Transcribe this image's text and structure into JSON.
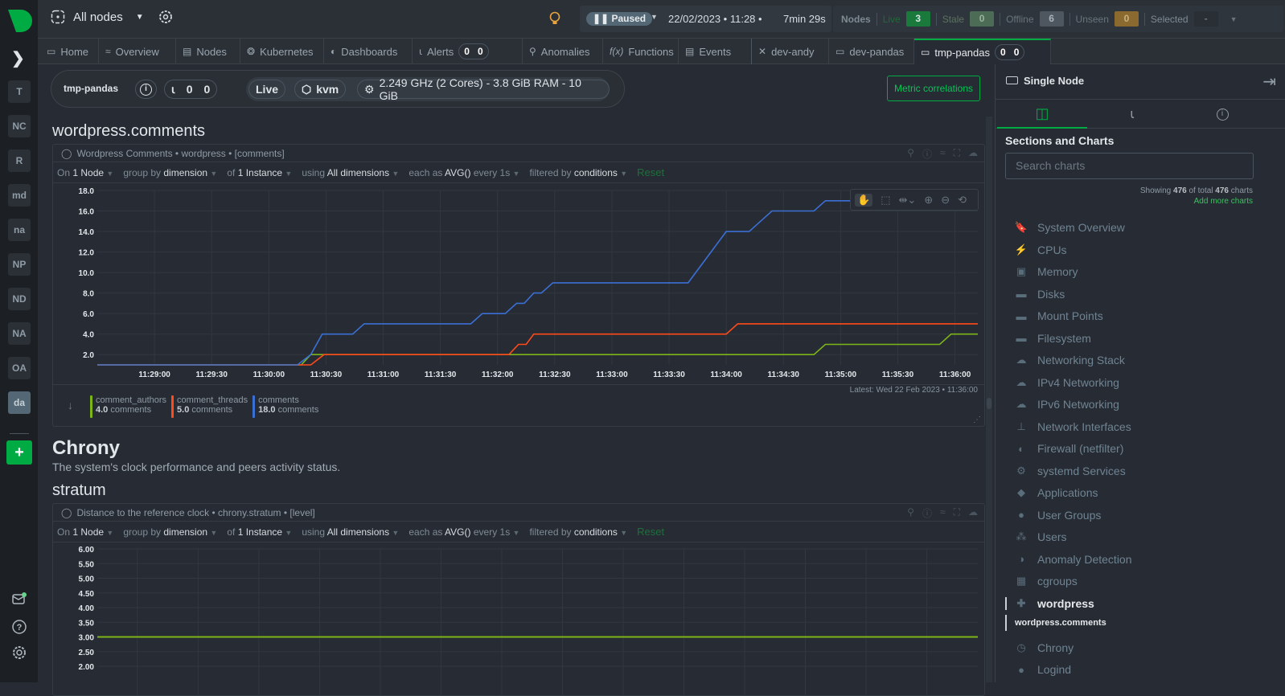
{
  "topbar": {
    "room_label": "All nodes",
    "paused_label": "Paused",
    "date": "22/02/2023 • 11:28 •",
    "duration": "7min 29s",
    "nodes_label": "Nodes",
    "live_label": "Live",
    "live_count": "3",
    "stale_label": "Stale",
    "stale_count": "0",
    "offline_label": "Offline",
    "offline_count": "6",
    "unseen_label": "Unseen",
    "unseen_count": "0",
    "selected_label": "Selected",
    "selected_count": "-"
  },
  "spaces": [
    "T",
    "NC",
    "R",
    "md",
    "na",
    "NP",
    "ND",
    "NA",
    "OA",
    "da"
  ],
  "tabs": [
    {
      "label": "Home",
      "icon": "monitor-icon"
    },
    {
      "label": "Overview",
      "icon": "overview-icon"
    },
    {
      "label": "Nodes",
      "icon": "server-icon"
    },
    {
      "label": "Kubernetes",
      "icon": "kubernetes-icon"
    },
    {
      "label": "Dashboards",
      "icon": "dashboard-icon"
    },
    {
      "label": "Alerts",
      "icon": "bell-icon",
      "c1": "0",
      "c2": "0"
    },
    {
      "label": "Anomalies",
      "icon": "anomaly-icon"
    },
    {
      "label": "Functions",
      "icon": "function-icon"
    },
    {
      "label": "Events",
      "icon": "events-icon"
    },
    {
      "label": "dev-andy",
      "icon": "close-icon"
    },
    {
      "label": "dev-pandas",
      "icon": "node-icon"
    },
    {
      "label": "tmp-pandas",
      "icon": "node-icon",
      "c1": "0",
      "c2": "0"
    }
  ],
  "nodeinfo": {
    "name": "tmp-pandas",
    "alerts_c1": "0",
    "alerts_c2": "0",
    "live": "Live",
    "virt": "kvm",
    "specs": "2.249 GHz (2 Cores) - 3.8 GiB RAM - 10 GiB"
  },
  "metric_correlations": "Metric correlations",
  "wordpress": {
    "heading": "wordpress.comments",
    "card_title": "Wordpress Comments • wordpress • [comments]",
    "latest": "Latest: Wed 22 Feb 2023 • 11:36:00"
  },
  "filters": {
    "on": "On",
    "nodes": "1 Node",
    "group_by": "group by",
    "dimension": "dimension",
    "of": "of",
    "instances": "1 Instance",
    "using": "using",
    "dims": "All dimensions",
    "each_as": "each as",
    "agg": "AVG()",
    "every": "every 1s",
    "filtered_by": "filtered by",
    "conditions": "conditions",
    "reset": "Reset"
  },
  "chrony": {
    "heading": "Chrony",
    "description": "The system's clock performance and peers activity status.",
    "sub_heading": "stratum",
    "card_title": "Distance to the reference clock • chrony.stratum • [level]"
  },
  "chart_data": [
    {
      "type": "line",
      "title": "Wordpress Comments • wordpress • [comments]",
      "xlabel": "",
      "ylabel": "comments",
      "x_ticks": [
        "11:29:00",
        "11:29:30",
        "11:30:00",
        "11:30:30",
        "11:31:00",
        "11:31:30",
        "11:32:00",
        "11:32:30",
        "11:33:00",
        "11:33:30",
        "11:34:00",
        "11:34:30",
        "11:35:00",
        "11:35:30",
        "11:36:00"
      ],
      "y_ticks": [
        "2.0",
        "4.0",
        "6.0",
        "8.0",
        "10.0",
        "12.0",
        "14.0",
        "16.0",
        "18.0"
      ],
      "ylim": [
        1,
        18
      ],
      "xlim_seconds": [
        -30,
        432
      ],
      "x_seconds_from_11_29_00": true,
      "grid": true,
      "legend": "bottom-left",
      "series": [
        {
          "name": "comment_authors",
          "color": "#7cb518",
          "latest": "4.0",
          "unit": "comments",
          "points": [
            [
              -30,
              1
            ],
            [
              77,
              1
            ],
            [
              82,
              2
            ],
            [
              346,
              2
            ],
            [
              352,
              3
            ],
            [
              412,
              3
            ],
            [
              418,
              4
            ],
            [
              432,
              4
            ]
          ]
        },
        {
          "name": "comment_threads",
          "color": "#ff4a1a",
          "latest": "5.0",
          "unit": "comments",
          "points": [
            [
              -30,
              1
            ],
            [
              77,
              1
            ],
            [
              82,
              1
            ],
            [
              89,
              2
            ],
            [
              186,
              2
            ],
            [
              191,
              3
            ],
            [
              195,
              3
            ],
            [
              199,
              4
            ],
            [
              300,
              4
            ],
            [
              306,
              5
            ],
            [
              432,
              5
            ]
          ]
        },
        {
          "name": "comments",
          "color": "#3b6fd4",
          "latest": "18.0",
          "unit": "comments",
          "points": [
            [
              -30,
              1
            ],
            [
              75,
              1
            ],
            [
              82,
              2
            ],
            [
              88,
              4
            ],
            [
              104,
              4
            ],
            [
              110,
              5
            ],
            [
              166,
              5
            ],
            [
              172,
              6
            ],
            [
              184,
              6
            ],
            [
              190,
              7
            ],
            [
              194,
              7
            ],
            [
              199,
              8
            ],
            [
              203,
              8
            ],
            [
              209,
              9
            ],
            [
              280,
              9
            ],
            [
              300,
              14
            ],
            [
              312,
              14
            ],
            [
              324,
              16
            ],
            [
              346,
              16
            ],
            [
              352,
              17
            ],
            [
              408,
              17
            ],
            [
              415,
              18
            ],
            [
              432,
              18
            ]
          ]
        }
      ]
    },
    {
      "type": "line",
      "title": "Distance to the reference clock • chrony.stratum • [level]",
      "y_ticks": [
        "2.00",
        "2.50",
        "3.00",
        "3.50",
        "4.00",
        "4.50",
        "5.00",
        "5.50",
        "6.00"
      ],
      "ylim": [
        2,
        6
      ],
      "grid": true,
      "series": [
        {
          "name": "stratum",
          "color": "#7cb518",
          "points": [
            [
              0,
              3
            ],
            [
              1,
              3
            ]
          ]
        }
      ]
    }
  ],
  "right_panel": {
    "title": "Single Node",
    "sections_title": "Sections and Charts",
    "search_placeholder": "Search charts",
    "showing": "Showing",
    "shown_count": "476",
    "of_total": "of total",
    "total_count": "476",
    "charts": "charts",
    "add_more": "Add more charts",
    "items": [
      {
        "label": "System Overview",
        "icon": "bookmark-icon",
        "glyph": "🔖"
      },
      {
        "label": "CPUs",
        "icon": "bolt-icon",
        "glyph": "⚡"
      },
      {
        "label": "Memory",
        "icon": "chip-icon",
        "glyph": "▣"
      },
      {
        "label": "Disks",
        "icon": "disk-icon",
        "glyph": "▬"
      },
      {
        "label": "Mount Points",
        "icon": "disk-icon",
        "glyph": "▬"
      },
      {
        "label": "Filesystem",
        "icon": "disk-icon",
        "glyph": "▬"
      },
      {
        "label": "Networking Stack",
        "icon": "cloud-icon",
        "glyph": "☁"
      },
      {
        "label": "IPv4 Networking",
        "icon": "cloud-icon",
        "glyph": "☁"
      },
      {
        "label": "IPv6 Networking",
        "icon": "cloud-icon",
        "glyph": "☁"
      },
      {
        "label": "Network Interfaces",
        "icon": "network-icon",
        "glyph": "⊥"
      },
      {
        "label": "Firewall (netfilter)",
        "icon": "shield-icon",
        "glyph": "◐"
      },
      {
        "label": "systemd Services",
        "icon": "gears-icon",
        "glyph": "⚙"
      },
      {
        "label": "Applications",
        "icon": "applications-icon",
        "glyph": "◆"
      },
      {
        "label": "User Groups",
        "icon": "user-icon",
        "glyph": "●"
      },
      {
        "label": "Users",
        "icon": "users-icon",
        "glyph": "⁂"
      },
      {
        "label": "Anomaly Detection",
        "icon": "brain-icon",
        "glyph": "◑"
      },
      {
        "label": "cgroups",
        "icon": "grid-icon",
        "glyph": "▦"
      },
      {
        "label": "wordpress",
        "icon": "puzzle-icon",
        "glyph": "✚",
        "active": true
      },
      {
        "label": "Chrony",
        "icon": "clock-icon",
        "glyph": "◷"
      },
      {
        "label": "Logind",
        "icon": "user-icon",
        "glyph": "●"
      }
    ],
    "sub_item": "wordpress.comments"
  }
}
